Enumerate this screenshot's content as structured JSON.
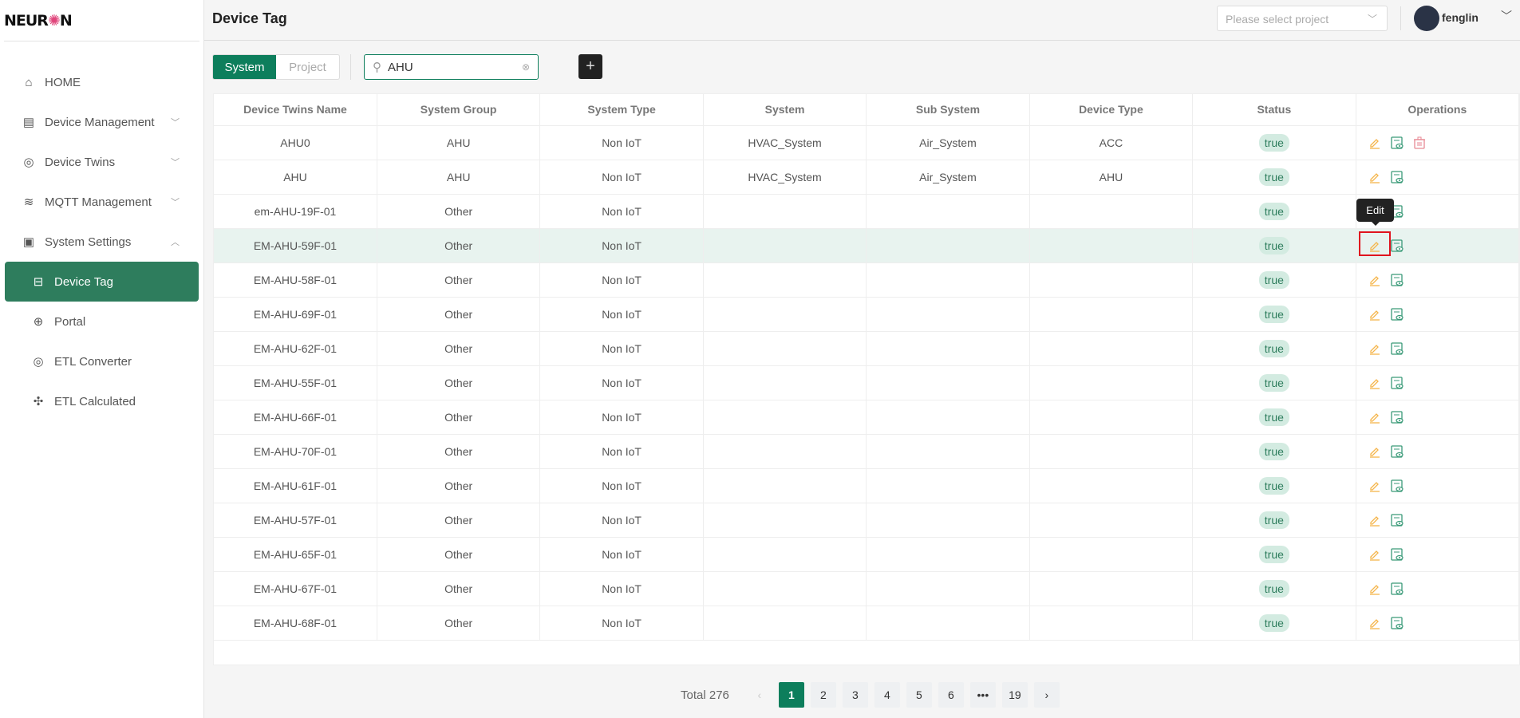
{
  "logo": "NEURON",
  "sidebar": {
    "items": [
      {
        "label": "HOME",
        "icon": "home-icon"
      },
      {
        "label": "Device Management",
        "icon": "server-icon",
        "chevron": "down"
      },
      {
        "label": "Device Twins",
        "icon": "cube-icon",
        "chevron": "down"
      },
      {
        "label": "MQTT Management",
        "icon": "router-icon",
        "chevron": "down"
      },
      {
        "label": "System Settings",
        "icon": "monitor-icon",
        "chevron": "up"
      },
      {
        "label": "Device Tag",
        "icon": "tag-device-icon",
        "active": true
      },
      {
        "label": "Portal",
        "icon": "globe-icon"
      },
      {
        "label": "ETL Converter",
        "icon": "cube-icon"
      },
      {
        "label": "ETL Calculated",
        "icon": "fan-icon"
      }
    ]
  },
  "header": {
    "title": "Device Tag",
    "project_placeholder": "Please select project",
    "user": "fenglin"
  },
  "toolbar": {
    "tabs": [
      "System",
      "Project"
    ],
    "active_tab": "System",
    "search_value": "AHU",
    "add_label": "+"
  },
  "table": {
    "columns": [
      "Device Twins Name",
      "System Group",
      "System Type",
      "System",
      "Sub System",
      "Device Type",
      "Status",
      "Operations"
    ],
    "rows": [
      [
        "AHU0",
        "AHU",
        "Non IoT",
        "HVAC_System",
        "Air_System",
        "ACC",
        "true"
      ],
      [
        "AHU",
        "AHU",
        "Non IoT",
        "HVAC_System",
        "Air_System",
        "AHU",
        "true"
      ],
      [
        "em-AHU-19F-01",
        "Other",
        "Non IoT",
        "",
        "",
        "",
        "true"
      ],
      [
        "EM-AHU-59F-01",
        "Other",
        "Non IoT",
        "",
        "",
        "",
        "true"
      ],
      [
        "EM-AHU-58F-01",
        "Other",
        "Non IoT",
        "",
        "",
        "",
        "true"
      ],
      [
        "EM-AHU-69F-01",
        "Other",
        "Non IoT",
        "",
        "",
        "",
        "true"
      ],
      [
        "EM-AHU-62F-01",
        "Other",
        "Non IoT",
        "",
        "",
        "",
        "true"
      ],
      [
        "EM-AHU-55F-01",
        "Other",
        "Non IoT",
        "",
        "",
        "",
        "true"
      ],
      [
        "EM-AHU-66F-01",
        "Other",
        "Non IoT",
        "",
        "",
        "",
        "true"
      ],
      [
        "EM-AHU-70F-01",
        "Other",
        "Non IoT",
        "",
        "",
        "",
        "true"
      ],
      [
        "EM-AHU-61F-01",
        "Other",
        "Non IoT",
        "",
        "",
        "",
        "true"
      ],
      [
        "EM-AHU-57F-01",
        "Other",
        "Non IoT",
        "",
        "",
        "",
        "true"
      ],
      [
        "EM-AHU-65F-01",
        "Other",
        "Non IoT",
        "",
        "",
        "",
        "true"
      ],
      [
        "EM-AHU-67F-01",
        "Other",
        "Non IoT",
        "",
        "",
        "",
        "true"
      ],
      [
        "EM-AHU-68F-01",
        "Other",
        "Non IoT",
        "",
        "",
        "",
        "true"
      ]
    ],
    "highlighted_row": 3,
    "tooltip": "Edit"
  },
  "pagination": {
    "total_label": "Total 276",
    "pages": [
      "1",
      "2",
      "3",
      "4",
      "5",
      "6",
      "•••",
      "19"
    ],
    "current": "1"
  },
  "colors": {
    "accent": "#0d7e5c",
    "sidebar_active": "#2e7d5d",
    "edit": "#f5b54a",
    "view": "#3a9a78",
    "delete": "#e88a95"
  }
}
